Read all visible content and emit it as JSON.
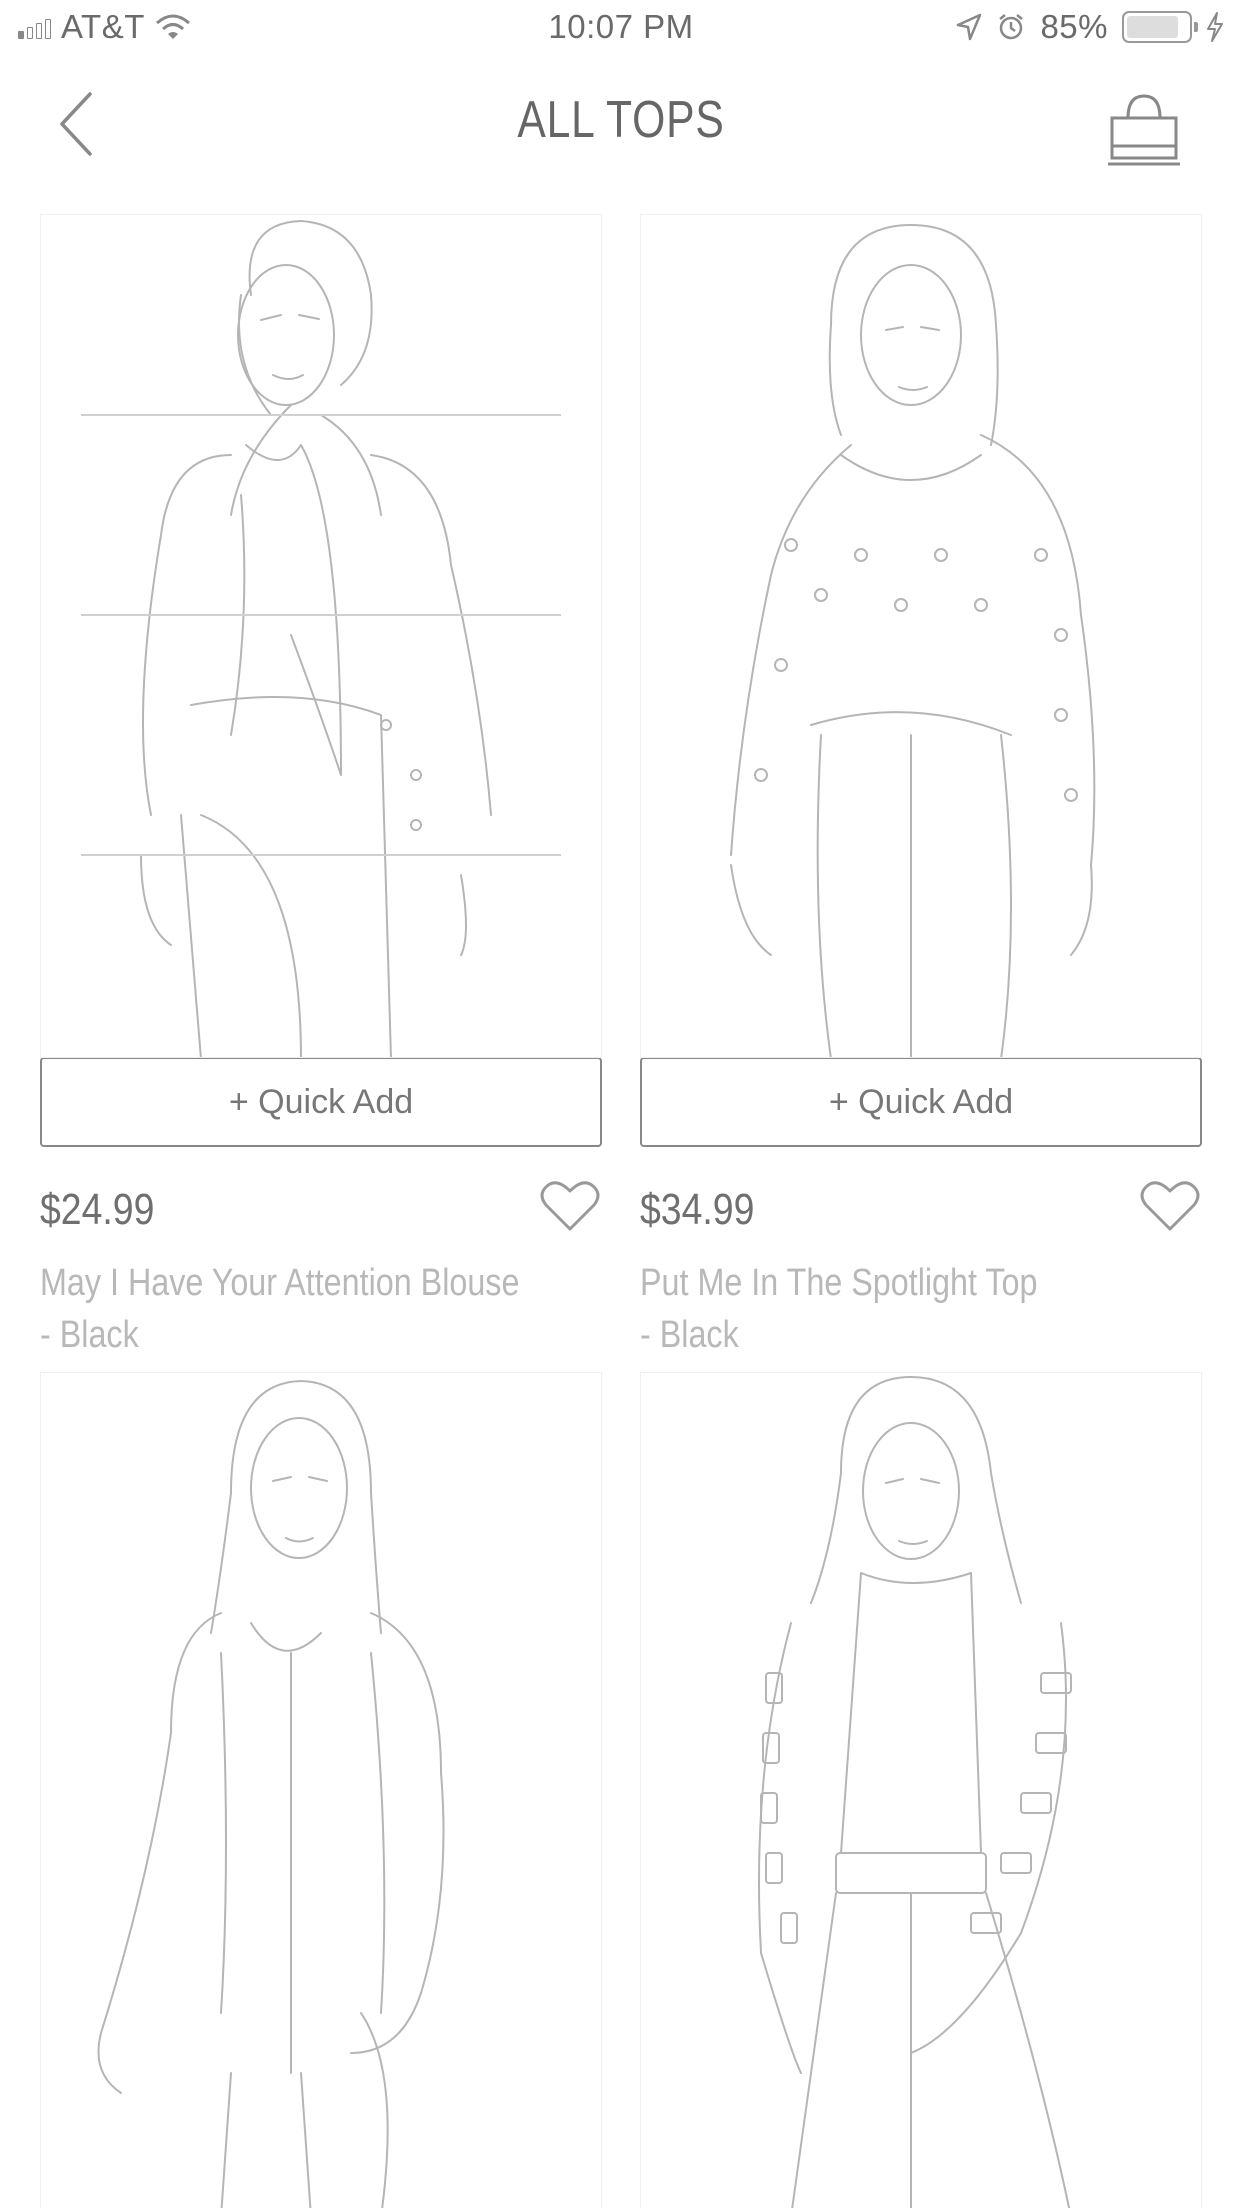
{
  "status_bar": {
    "carrier": "AT&T",
    "time": "10:07 PM",
    "battery": "85%",
    "battery_level": 0.85
  },
  "nav": {
    "title": "ALL TOPS",
    "back_icon": "chevron-left-icon",
    "bag_icon": "shopping-bag-icon"
  },
  "products": [
    {
      "quick_add": "+ Quick Add",
      "price": "$24.99",
      "name_line1": "May I Have Your Attention Blouse",
      "name_line2": "- Black"
    },
    {
      "quick_add": "+ Quick Add",
      "price": "$34.99",
      "name_line1": "Put Me In The Spotlight Top",
      "name_line2": "- Black"
    },
    {},
    {}
  ]
}
